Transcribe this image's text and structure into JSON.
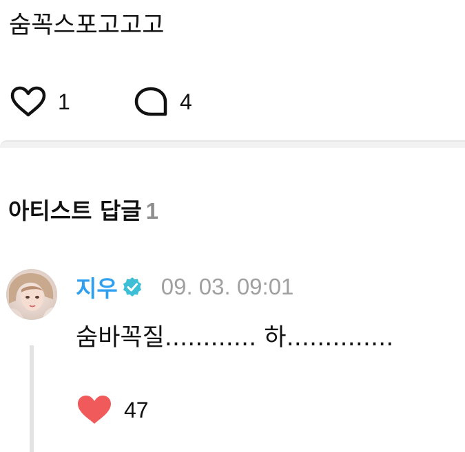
{
  "post": {
    "text": "숨꼭스포고고고",
    "like_count": "1",
    "comment_count": "4"
  },
  "section": {
    "title": "아티스트 답글",
    "count": "1"
  },
  "reply": {
    "author": "지우",
    "timestamp": "09. 03. 09:01",
    "text": "숨바꼭질............ 하..............",
    "like_count": "47",
    "liked": true
  },
  "colors": {
    "author": "#2f9ff0",
    "verified_badge": "#3fbfd6",
    "heart_filled": "#f05a5a",
    "meta_gray": "#a0a0a0",
    "divider": "#f2f2f2"
  },
  "icons": {
    "like": "heart-outline-icon",
    "comment": "speech-bubble-icon",
    "verified": "verified-check-icon",
    "reply_like": "heart-filled-icon"
  }
}
